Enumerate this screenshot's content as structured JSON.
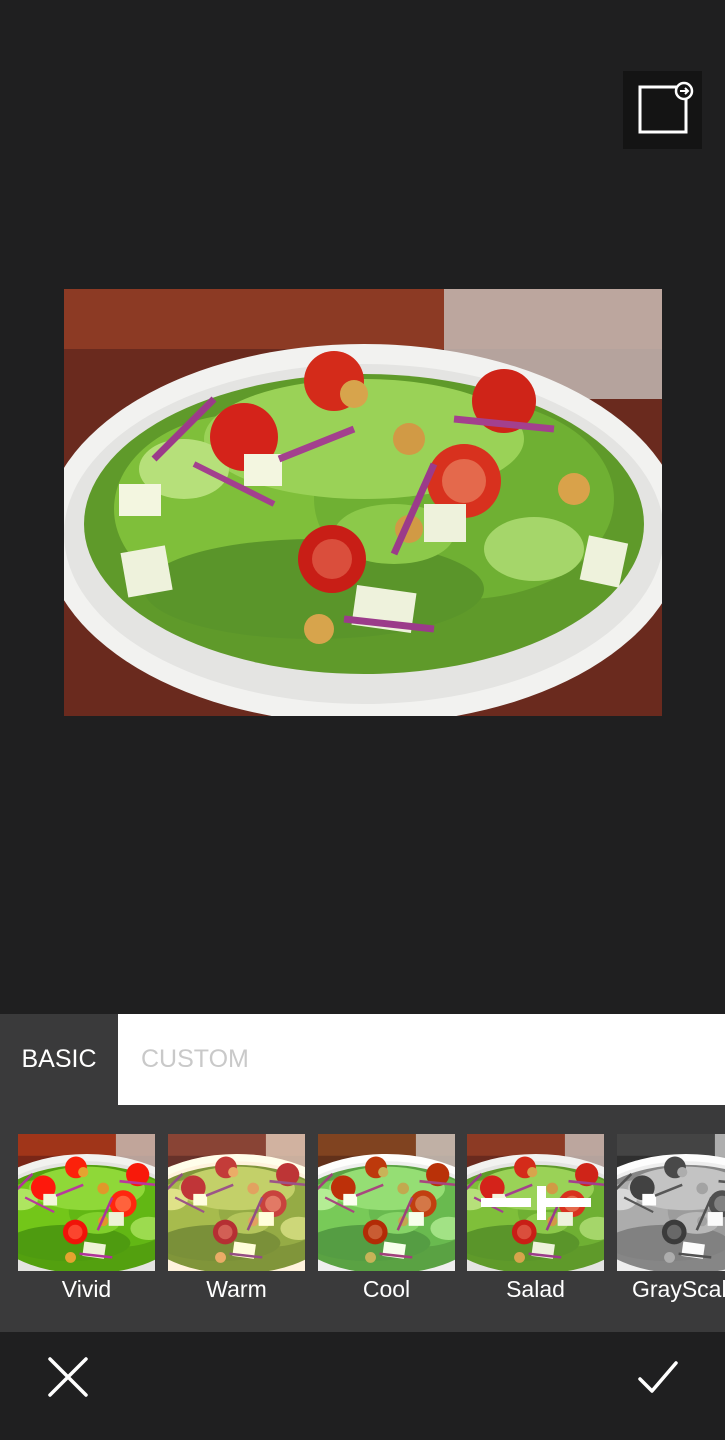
{
  "tabs": {
    "basic_label": "BASIC",
    "custom_label": "CUSTOM",
    "active": "BASIC"
  },
  "filters": [
    {
      "label": "Vivid",
      "icon": "salad-thumbnail"
    },
    {
      "label": "Warm",
      "icon": "salad-thumbnail"
    },
    {
      "label": "Cool",
      "icon": "salad-thumbnail"
    },
    {
      "label": "Salad",
      "icon": "adjust-sliders-icon",
      "selected": true
    },
    {
      "label": "GrayScal",
      "icon": "salad-thumbnail"
    }
  ],
  "icons": {
    "compare": "compare-original-icon",
    "cancel": "close-icon",
    "confirm": "check-icon"
  },
  "colors": {
    "background": "#1f1f20",
    "panel": "#3a3a3b",
    "tab_inactive_text": "#c9c9c9",
    "text": "#ffffff"
  }
}
